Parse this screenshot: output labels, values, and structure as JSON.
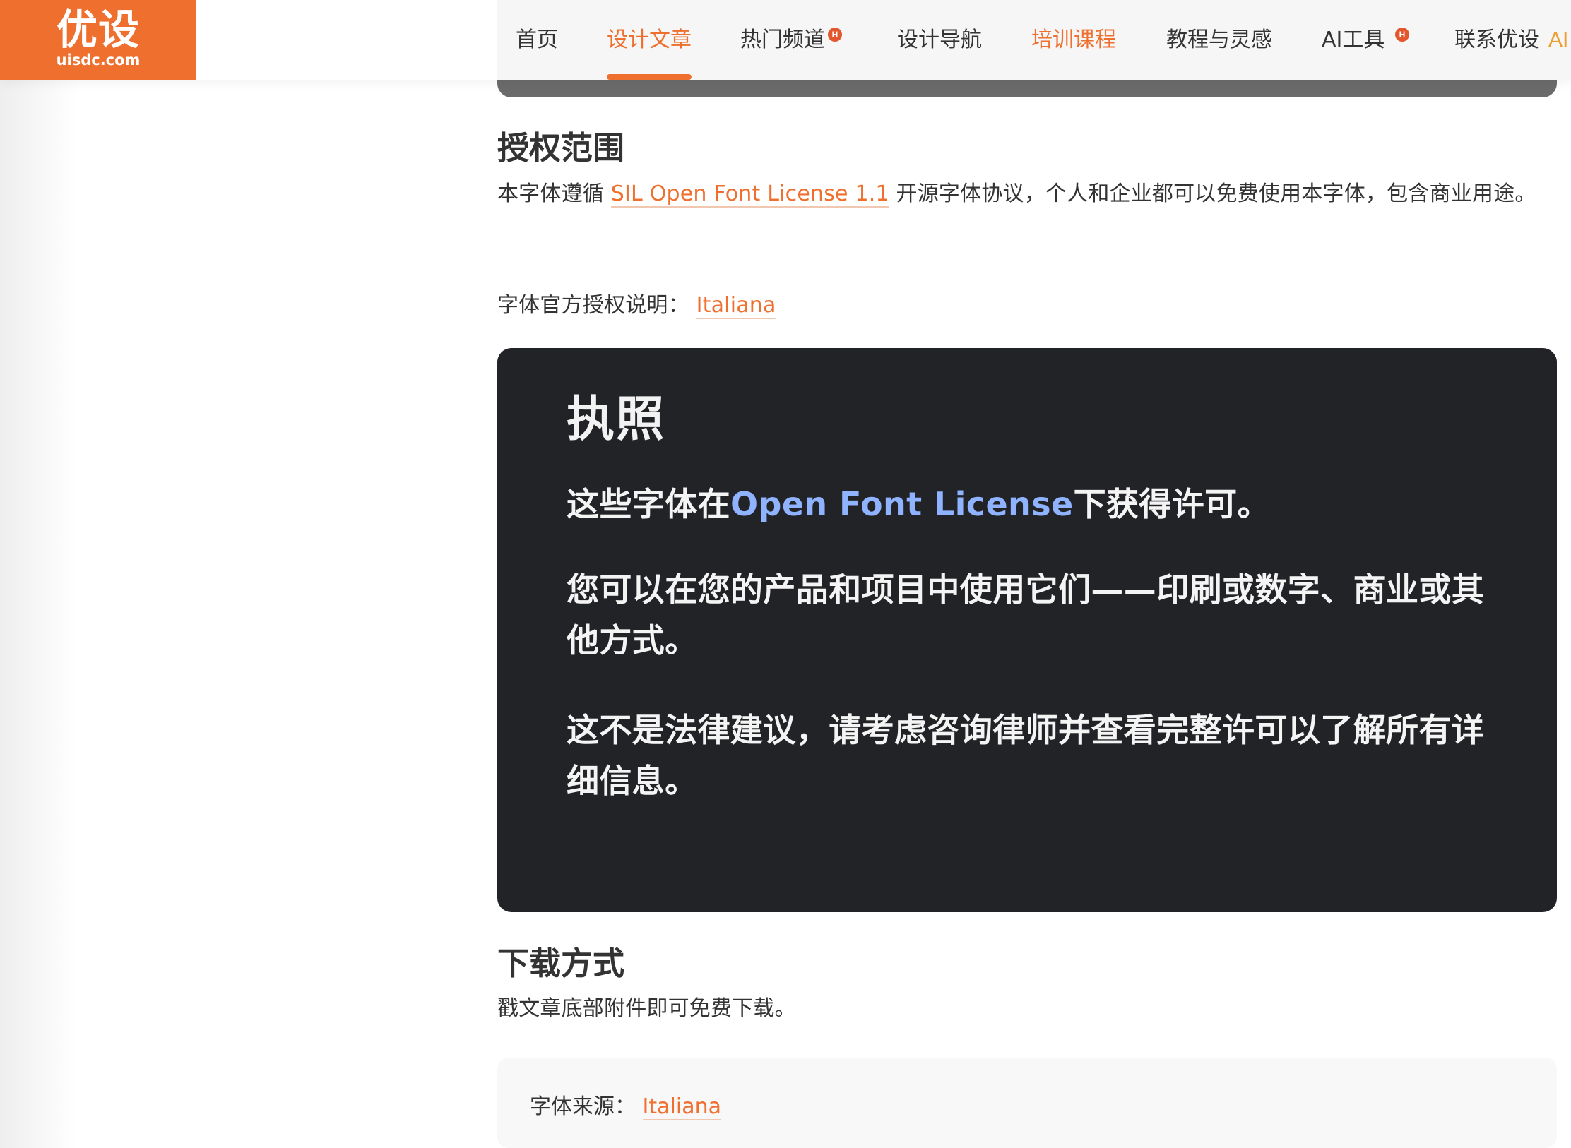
{
  "header": {
    "logo_cn": "优设",
    "logo_domain": "uisdc.com",
    "nav": [
      {
        "label": "首页",
        "state": "normal",
        "badge": ""
      },
      {
        "label": "设计文章",
        "state": "active",
        "badge": ""
      },
      {
        "label": "热门频道",
        "state": "normal",
        "badge": "H"
      },
      {
        "label": "设计导航",
        "state": "normal",
        "badge": ""
      },
      {
        "label": "培训课程",
        "state": "highlight",
        "badge": ""
      },
      {
        "label": "教程与灵感",
        "state": "normal",
        "badge": ""
      },
      {
        "label": "AI工具",
        "state": "normal",
        "badge": "H"
      },
      {
        "label": "联系优设",
        "state": "normal",
        "badge": ""
      }
    ],
    "truncated_nav": "AI"
  },
  "article": {
    "section_license": {
      "title": "授权范围",
      "paragraph_prefix": "本字体遵循 ",
      "license_link": "SIL Open Font License 1.1",
      "paragraph_suffix": " 开源字体协议，个人和企业都可以免费使用本字体，包含商业用途。",
      "official_label": "字体官方授权说明：",
      "official_link": "Italiana"
    },
    "license_card": {
      "title": "执照",
      "p1_prefix": "这些字体在",
      "p1_link": "Open Font License",
      "p1_suffix": "下获得许可。",
      "p2": "您可以在您的产品和项目中使用它们——印刷或数字、商业或其他方式。",
      "p3": "这不是法律建议，请考虑咨询律师并查看完整许可以了解所有详细信息。"
    },
    "section_download": {
      "title": "下载方式",
      "paragraph": "戳文章底部附件即可免费下载。",
      "source_label": "字体来源：",
      "source_link": "Italiana"
    }
  },
  "colors": {
    "brand": "#ef6f2e",
    "text": "#333333",
    "card_bg": "#212327",
    "card_link": "#8fb3ff"
  }
}
